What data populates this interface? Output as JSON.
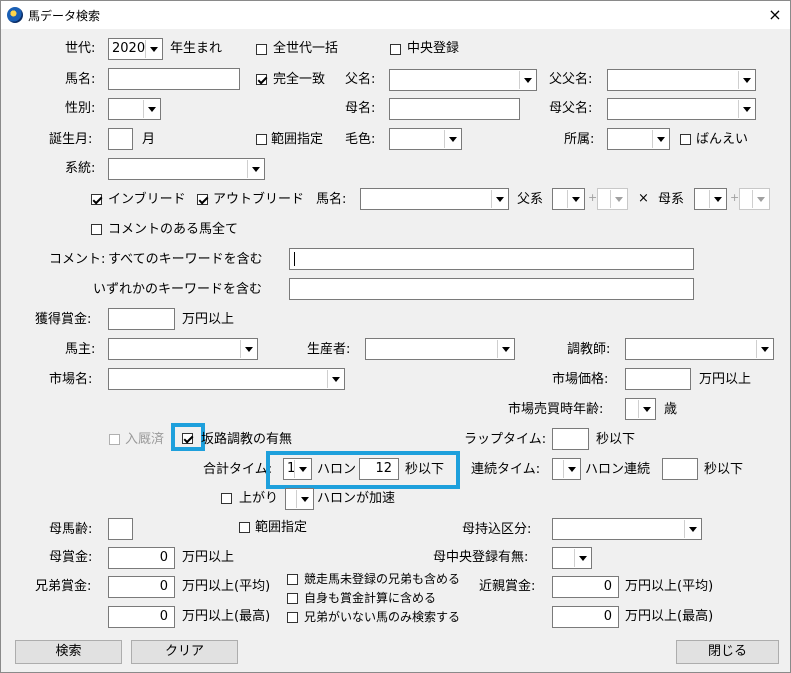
{
  "window": {
    "title": "馬データ検索",
    "close_symbol": "×"
  },
  "row1": {
    "era_label": "世代:",
    "era_value": "2020",
    "born_label": "年生まれ",
    "all_gen_label": "全世代一括",
    "central_label": "中央登録"
  },
  "row2": {
    "horse_label": "馬名:",
    "exact_label": "完全一致",
    "father_label": "父名:",
    "ff_label": "父父名:"
  },
  "row3": {
    "sex_label": "性別:",
    "mother_label": "母名:",
    "mf_label": "母父名:"
  },
  "row4": {
    "birth_label": "誕生月:",
    "month_unit": "月",
    "range_label": "範囲指定",
    "coat_label": "毛色:",
    "affil_label": "所属:",
    "banei_label": "ばんえい"
  },
  "row5": {
    "lineage_label": "系統:"
  },
  "row6": {
    "inbreed_label": "インブリード",
    "outbreed_label": "アウトブリード",
    "horse_label": "馬名:",
    "sire_label": "父系",
    "plus": "+",
    "times": "×",
    "dam_label": "母系"
  },
  "row7": {
    "comment_horse_label": "コメントのある馬全て"
  },
  "comment": {
    "label": "コメント:",
    "all_label": "すべてのキーワードを含む",
    "any_label": "いずれかのキーワードを含む"
  },
  "prize": {
    "label": "獲得賞金:",
    "unit": "万円以上"
  },
  "owner": {
    "label": "馬主:",
    "breeder_label": "生産者:",
    "trainer_label": "調教師:"
  },
  "market": {
    "label": "市場名:",
    "price_label": "市場価格:",
    "price_unit": "万円以上",
    "age_label": "市場売買時年齢:",
    "age_unit": "歳"
  },
  "training": {
    "stable_label": "入厩済",
    "slope_label": "坂路調教の有無",
    "lap_label": "ラップタイム:",
    "lap_unit": "秒以下"
  },
  "total": {
    "label": "合計タイム:",
    "furlong_value": "1",
    "furlong_label": "ハロン",
    "seconds_value": "12",
    "seconds_label": "秒以下",
    "cont_label": "連続タイム:",
    "cont_furlong": "ハロン連続",
    "cont_unit": "秒以下"
  },
  "accel": {
    "up_label": "上がり",
    "accel_label": "ハロンが加速"
  },
  "dam": {
    "age_label": "母馬齢:",
    "range_label": "範囲指定",
    "import_label": "母持込区分:",
    "prize_label": "母賞金:",
    "prize_value": "0",
    "prize_unit": "万円以上",
    "central_label": "母中央登録有無:"
  },
  "sibling": {
    "label": "兄弟賞金:",
    "avg_value": "0",
    "avg_unit": "万円以上(平均)",
    "max_value": "0",
    "max_unit": "万円以上(最高)",
    "opt1": "競走馬未登録の兄弟も含める",
    "opt2": "自身も賞金計算に含める",
    "opt3": "兄弟がいない馬のみ検索する",
    "kin_label": "近親賞金:",
    "kin_avg_value": "0",
    "kin_avg_unit": "万円以上(平均)",
    "kin_max_value": "0",
    "kin_max_unit": "万円以上(最高)"
  },
  "buttons": {
    "search": "検索",
    "clear": "クリア",
    "close": "閉じる"
  }
}
